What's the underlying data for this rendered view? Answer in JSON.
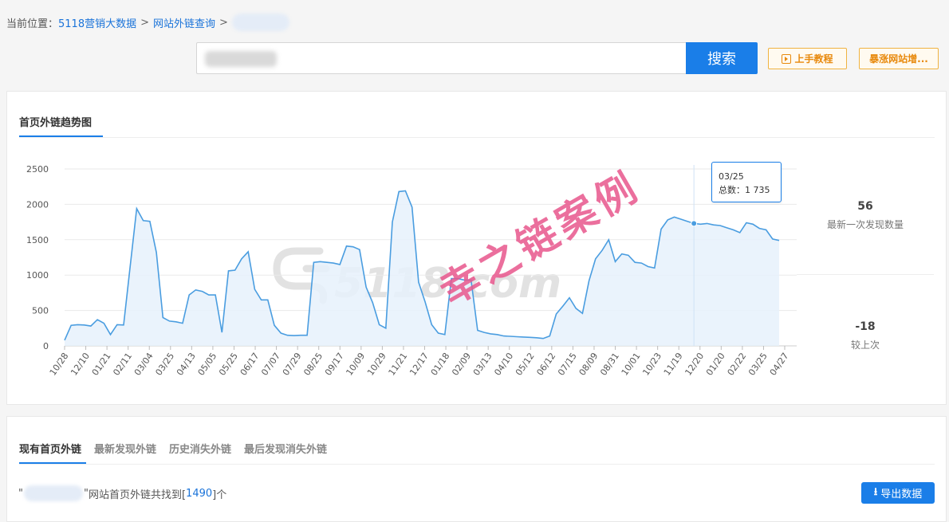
{
  "breadcrumb": {
    "prefix": "当前位置：",
    "items": [
      "5118营销大数据",
      "网站外链查询"
    ],
    "sep": ">"
  },
  "search": {
    "button": "搜索"
  },
  "actions": {
    "tutorial": "上手教程",
    "boost": "暴涨网站增..."
  },
  "panel": {
    "title": "首页外链趋势图"
  },
  "tooltip": {
    "date": "03/25",
    "total_label": "总数：",
    "total_value": "1 735"
  },
  "stats": [
    {
      "value": "56",
      "label": "最新一次发现数量"
    },
    {
      "value": "-18",
      "label": "较上次"
    }
  ],
  "watermark": {
    "text": "幸之链案例",
    "logo": "5118.com"
  },
  "tabs": [
    "现有首页外链",
    "最新发现外链",
    "历史消失外链",
    "最后发现消失外链"
  ],
  "summary": {
    "quote_open": "\"",
    "quote_close": "\"",
    "text": " 网站首页外链共找到[",
    "count": "1490",
    "suffix": "]个"
  },
  "export": {
    "label": "导出数据"
  },
  "colors": {
    "accent": "#1a7ee8",
    "line": "#4a9de0",
    "area": "#e6f1fb",
    "watermark": "#e8578d",
    "tutorial": "#e8890c"
  },
  "chart_data": {
    "type": "area",
    "ylim": [
      0,
      2500
    ],
    "yticks": [
      0,
      500,
      1000,
      1500,
      2000,
      2500
    ],
    "xticks": [
      "10/28",
      "12/10",
      "01/21",
      "02/11",
      "03/04",
      "03/25",
      "04/13",
      "05/05",
      "05/25",
      "06/17",
      "07/07",
      "07/29",
      "08/25",
      "09/17",
      "10/09",
      "10/29",
      "11/21",
      "12/17",
      "01/18",
      "02/09",
      "03/13",
      "04/10",
      "05/12",
      "06/12",
      "07/15",
      "08/09",
      "08/31",
      "10/01",
      "10/23",
      "11/19",
      "12/20",
      "01/20",
      "02/22",
      "03/25",
      "04/27"
    ],
    "highlight": {
      "label": "03/25",
      "value": 1735
    },
    "values": [
      80,
      290,
      300,
      295,
      280,
      370,
      320,
      160,
      300,
      295,
      1120,
      1940,
      1770,
      1760,
      1320,
      400,
      350,
      340,
      320,
      720,
      790,
      770,
      720,
      720,
      190,
      1060,
      1070,
      1230,
      1330,
      800,
      650,
      650,
      290,
      180,
      150,
      145,
      150,
      150,
      1180,
      1190,
      1180,
      1170,
      1150,
      1410,
      1400,
      1360,
      830,
      610,
      300,
      250,
      1750,
      2180,
      2190,
      1960,
      900,
      620,
      300,
      180,
      160,
      950,
      950,
      930,
      930,
      220,
      190,
      170,
      160,
      140,
      135,
      130,
      125,
      120,
      115,
      105,
      140,
      450,
      560,
      680,
      530,
      460,
      920,
      1230,
      1350,
      1500,
      1190,
      1300,
      1280,
      1180,
      1170,
      1120,
      1100,
      1650,
      1780,
      1820,
      1790,
      1760,
      1730,
      1720,
      1730,
      1710,
      1700,
      1670,
      1640,
      1600,
      1740,
      1720,
      1660,
      1640,
      1510,
      1490
    ]
  }
}
